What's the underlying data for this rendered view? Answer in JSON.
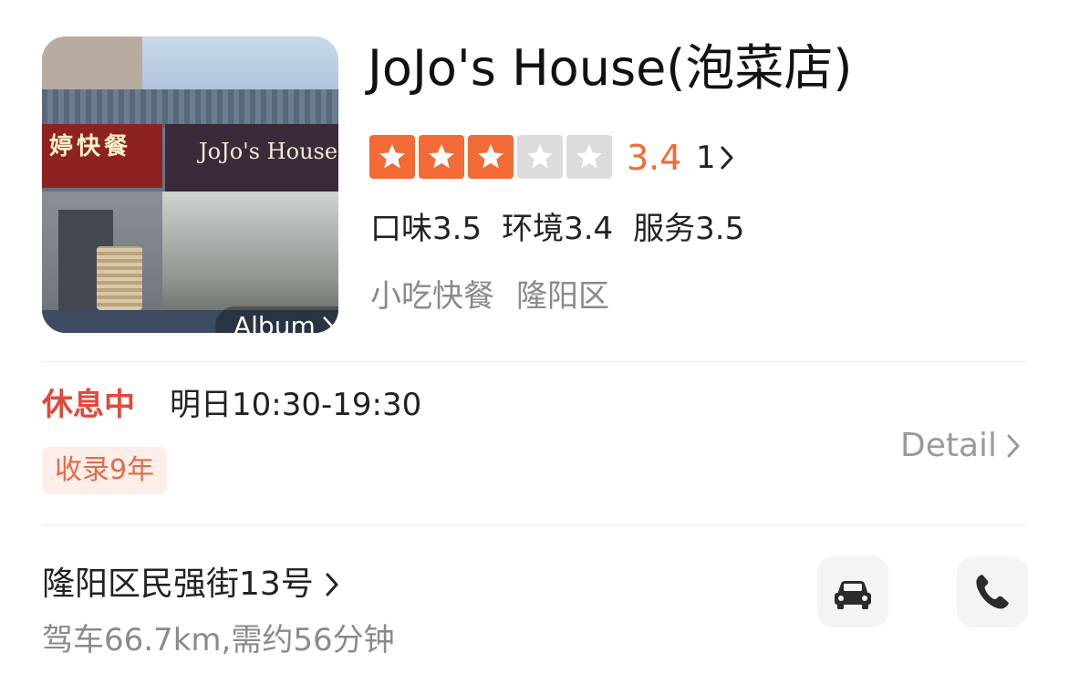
{
  "shop": {
    "photo_sign_left": "婷快餐",
    "photo_sign_right": "JoJo's House",
    "album_label": "Album",
    "name": "JoJo's House(泡菜店)",
    "rating": {
      "stars_filled": 3,
      "stars_total": 5,
      "score": "3.4",
      "review_count": "1"
    },
    "subscores": [
      {
        "label": "口味3.5"
      },
      {
        "label": "环境3.4"
      },
      {
        "label": "服务3.5"
      }
    ],
    "category": "小吃快餐",
    "district": "隆阳区"
  },
  "hours": {
    "status": "休息中",
    "text": "明日10:30-19:30",
    "badge": "收录9年",
    "detail_label": "Detail"
  },
  "address": {
    "street": "隆阳区民强街13号",
    "distance": "驾车66.7km,需约56分钟"
  },
  "icons": {
    "star": "star-icon",
    "chevron": "chevron-right-icon",
    "car": "car-icon",
    "phone": "phone-icon"
  },
  "colors": {
    "accent": "#f26a35",
    "status_red": "#e2483a",
    "badge_bg": "#fdeeea",
    "muted": "#8a8a8a"
  }
}
